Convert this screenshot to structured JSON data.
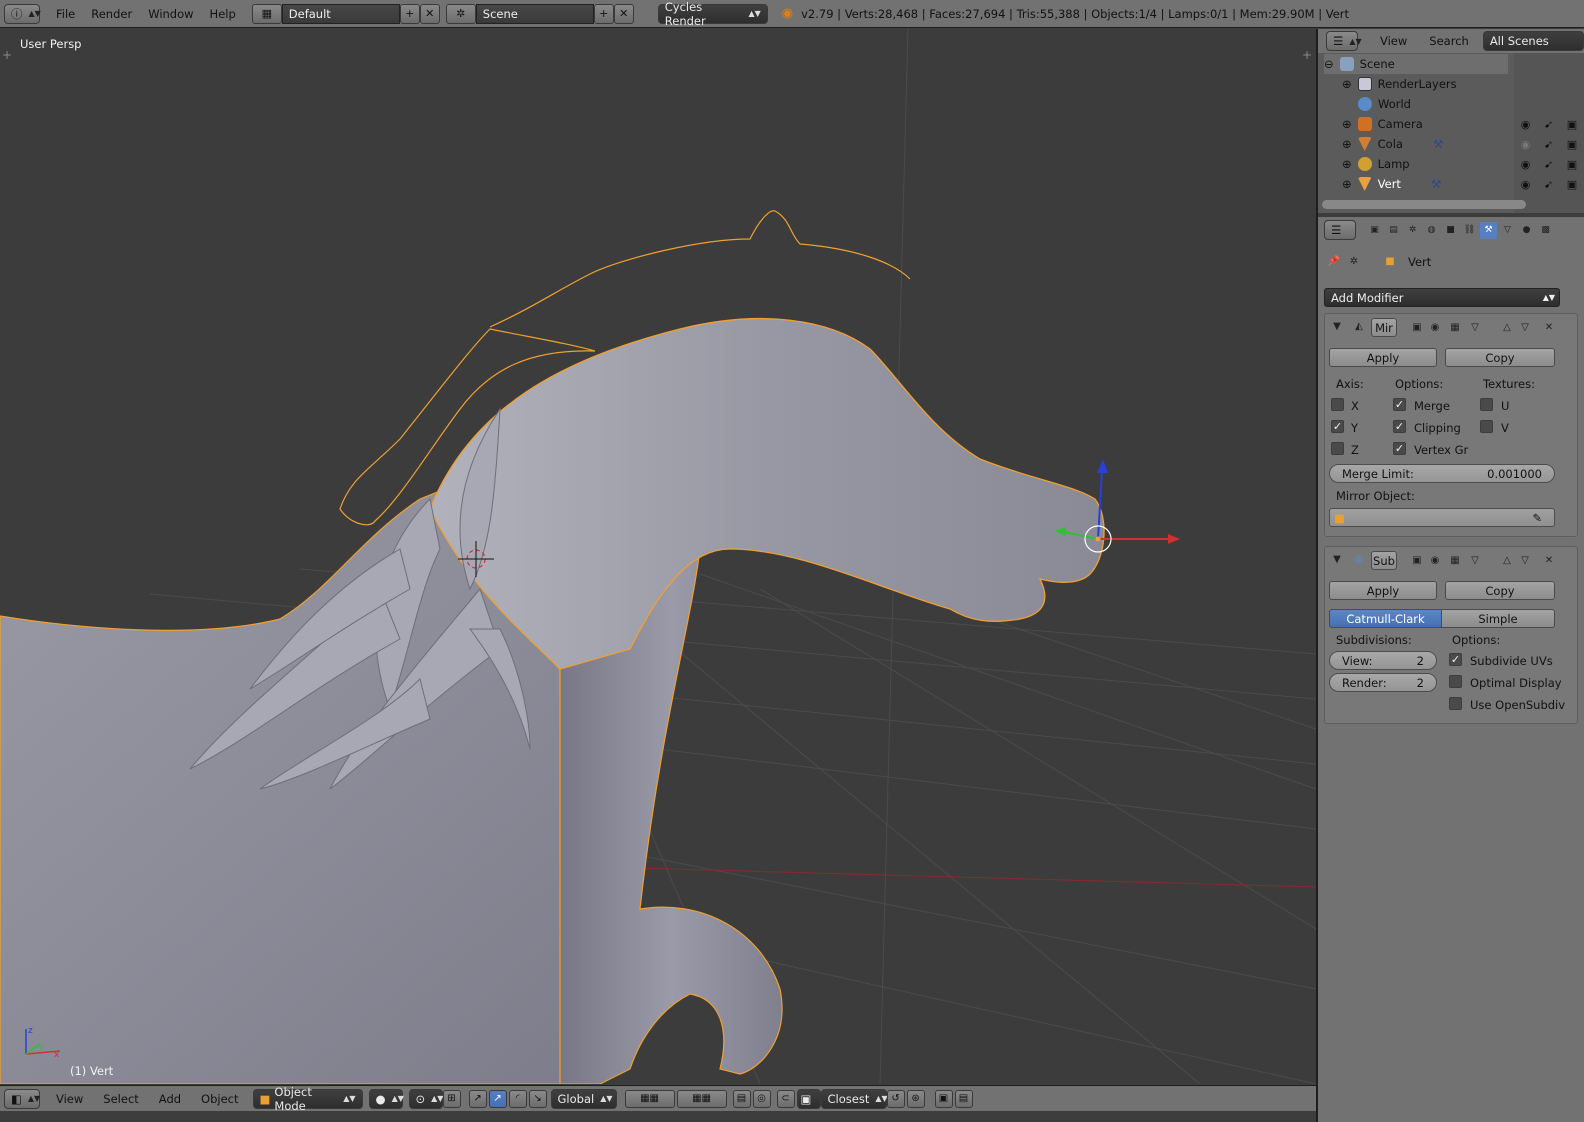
{
  "top_bar": {
    "menus": [
      "File",
      "Render",
      "Window",
      "Help"
    ],
    "layout": "Default",
    "scene": "Scene",
    "engine": "Cycles Render",
    "stats": "v2.79 | Verts:28,468 | Faces:27,694 | Tris:55,388 | Objects:1/4 | Lamps:0/1 | Mem:29.90M | Vert"
  },
  "viewport": {
    "view_name": "User Persp",
    "active_object": "(1) Vert",
    "axis_labels": {
      "x": "x",
      "y": "y",
      "z": "z"
    },
    "colors": {
      "selection_outline": "#f0a030",
      "mesh": "#8c8c9a",
      "grid": "#4a4a4a",
      "x_axis": "#d23030",
      "y_axis": "#30c030",
      "z_axis": "#2a3ed8"
    }
  },
  "bottom_bar": {
    "menus": [
      "View",
      "Select",
      "Add",
      "Object"
    ],
    "mode": "Object Mode",
    "orientation": "Global",
    "snap": "Closest"
  },
  "outliner": {
    "menus": [
      "View",
      "Search"
    ],
    "filter": "All Scenes",
    "items": [
      {
        "label": "Scene",
        "icon": "scene-icon"
      },
      {
        "label": "RenderLayers",
        "icon": "render-layers-icon"
      },
      {
        "label": "World",
        "icon": "world-icon"
      },
      {
        "label": "Camera",
        "icon": "camera-icon"
      },
      {
        "label": "Cola",
        "icon": "mesh-icon"
      },
      {
        "label": "Lamp",
        "icon": "lamp-icon"
      },
      {
        "label": "Vert",
        "icon": "mesh-icon"
      }
    ]
  },
  "properties": {
    "context_object": "Vert",
    "add_modifier": "Add Modifier",
    "mirror": {
      "name": "Mir",
      "apply": "Apply",
      "copy": "Copy",
      "axis_label": "Axis:",
      "options_label": "Options:",
      "textures_label": "Textures:",
      "axes": [
        {
          "label": "X",
          "checked": false
        },
        {
          "label": "Y",
          "checked": true
        },
        {
          "label": "Z",
          "checked": false
        }
      ],
      "options": [
        {
          "label": "Merge",
          "checked": true
        },
        {
          "label": "Clipping",
          "checked": true
        },
        {
          "label": "Vertex Gr",
          "checked": true
        }
      ],
      "textures": [
        {
          "label": "U",
          "checked": false
        },
        {
          "label": "V",
          "checked": false
        }
      ],
      "merge_limit_label": "Merge Limit:",
      "merge_limit_value": "0.001000",
      "mirror_object_label": "Mirror Object:"
    },
    "subsurf": {
      "name": "Sub",
      "apply": "Apply",
      "copy": "Copy",
      "tab_catmull": "Catmull-Clark",
      "tab_simple": "Simple",
      "subdivisions_label": "Subdivisions:",
      "options_label": "Options:",
      "view_label": "View:",
      "view_value": "2",
      "render_label": "Render:",
      "render_value": "2",
      "options": [
        {
          "label": "Subdivide UVs",
          "checked": true
        },
        {
          "label": "Optimal Display",
          "checked": false
        },
        {
          "label": "Use OpenSubdiv",
          "checked": false
        }
      ]
    }
  }
}
